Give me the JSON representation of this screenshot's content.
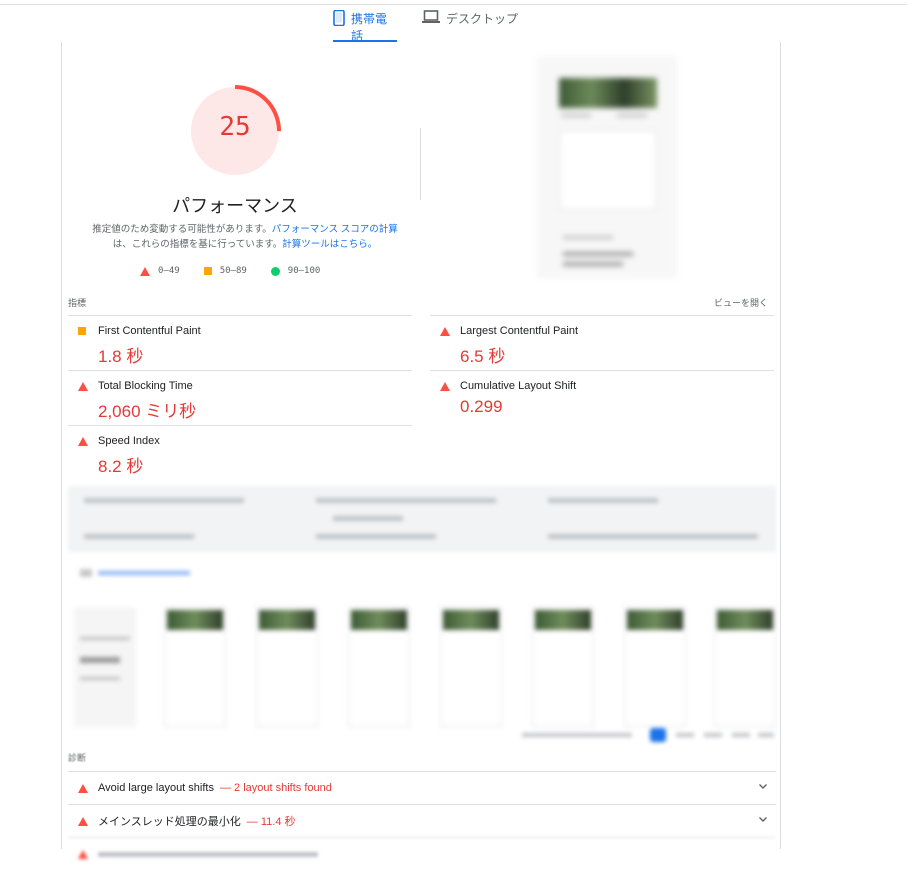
{
  "tabs": [
    {
      "label": "携帯電話",
      "icon": "smartphone-icon",
      "active": true
    },
    {
      "label": "デスクトップ",
      "icon": "laptop-icon",
      "active": false
    }
  ],
  "score": {
    "value": "25",
    "fraction": 0.25,
    "color": "#ff4e42",
    "bg": "#fee8e7"
  },
  "performance_title": "パフォーマンス",
  "note": {
    "text1": "推定値のため変動する可能性があります。",
    "link1": "パフォーマンス スコアの計算",
    "text2": "は、これらの指標を基に行っています。",
    "link2": "計算ツールはこちら。"
  },
  "legend": [
    {
      "range": "0–49",
      "shape": "triangle",
      "color": "#ff4e42"
    },
    {
      "range": "50–89",
      "shape": "square",
      "color": "#ffa400"
    },
    {
      "range": "90–100",
      "shape": "circle",
      "color": "#0cce6b"
    }
  ],
  "metrics_label": "指標",
  "expand_label": "ビューを開く",
  "metrics": [
    {
      "name": "First Contentful Paint",
      "value": "1.8 秒",
      "status": "average"
    },
    {
      "name": "Largest Contentful Paint",
      "value": "6.5 秒",
      "status": "fail"
    },
    {
      "name": "Total Blocking Time",
      "value": "2,060 ミリ秒",
      "status": "fail"
    },
    {
      "name": "Cumulative Layout Shift",
      "value": "0.299",
      "status": "fail"
    },
    {
      "name": "Speed Index",
      "value": "8.2 秒",
      "status": "fail"
    }
  ],
  "diagnostics_label": "診断",
  "audits": [
    {
      "title": "Avoid large layout shifts",
      "detail": "— 2 layout shifts found"
    },
    {
      "title": "メインスレッド処理の最小化",
      "detail": "— 11.4 秒"
    }
  ]
}
